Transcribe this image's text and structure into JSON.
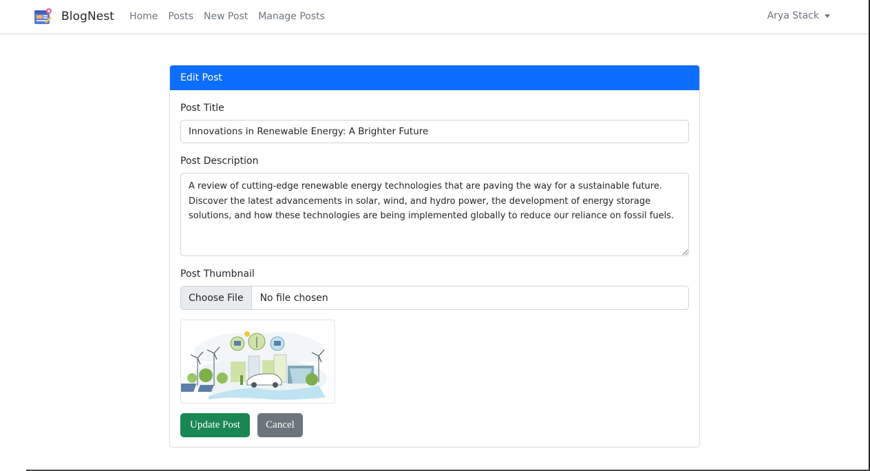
{
  "app": {
    "brand": "BlogNest"
  },
  "nav": {
    "links": [
      "Home",
      "Posts",
      "New Post",
      "Manage Posts"
    ],
    "user_name": "Arya Stack"
  },
  "card": {
    "header": "Edit Post"
  },
  "form": {
    "title_label": "Post Title",
    "title_value": "Innovations in Renewable Energy: A Brighter Future",
    "description_label": "Post Description",
    "description_value": "A review of cutting-edge renewable energy technologies that are paving the way for a sustainable future. Discover the latest advancements in solar, wind, and hydro power, the development of energy storage solutions, and how these technologies are being implemented globally to reduce our reliance on fossil fuels.",
    "thumbnail_label": "Post Thumbnail",
    "file_button": "Choose File",
    "file_status": "No file chosen",
    "thumbnail_icon": "renewable-energy-illustration"
  },
  "actions": {
    "update_label": "Update Post",
    "cancel_label": "Cancel"
  },
  "colors": {
    "primary": "#0d6efd",
    "success": "#198754",
    "secondary": "#6c757d"
  }
}
